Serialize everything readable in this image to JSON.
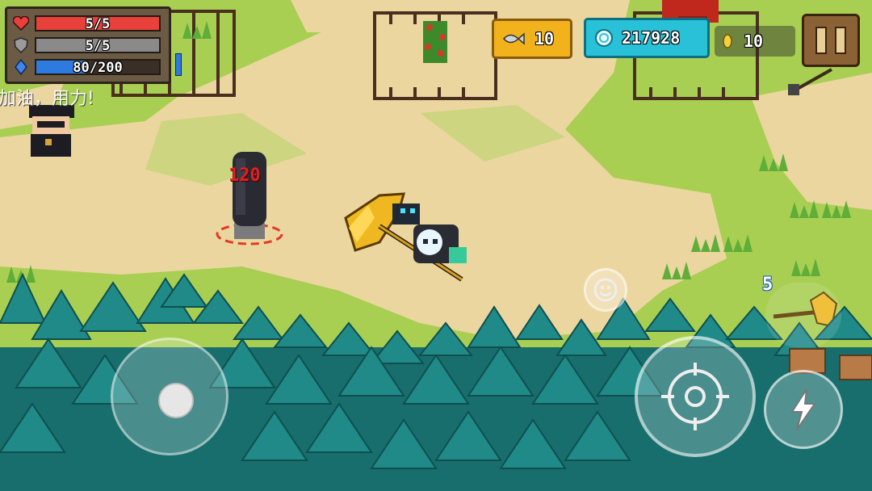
{
  "hud": {
    "health": {
      "text": "5/5",
      "value": 5,
      "max": 5,
      "color": "#e8403a"
    },
    "armor": {
      "text": "5/5",
      "value": 5,
      "max": 5,
      "color": "#8a8a8a"
    },
    "energy": {
      "text": "80/200",
      "value": 80,
      "max": 200,
      "color": "#2d7be0"
    },
    "fish_count": "10",
    "gems": "217928",
    "coins": "10"
  },
  "chat_text": "加油，用力!",
  "damage_number": "120",
  "weapon_ammo": "5",
  "icons": {
    "health": "heart-icon",
    "armor": "shield-icon",
    "energy": "energy-crystal-icon",
    "fish": "fish-icon",
    "gem": "gem-icon",
    "coin": "coin-icon",
    "pause": "pause-icon",
    "emote": "smiley-icon",
    "skill": "lightning-icon",
    "attack": "crosshair-icon"
  },
  "colors": {
    "grass": "#9fc94a",
    "sand": "#ecd6a0",
    "forest": "#1f8a88",
    "fish_chip": "#f1b21c",
    "gem_chip": "#28c1d8",
    "pause": "#8b6136"
  }
}
